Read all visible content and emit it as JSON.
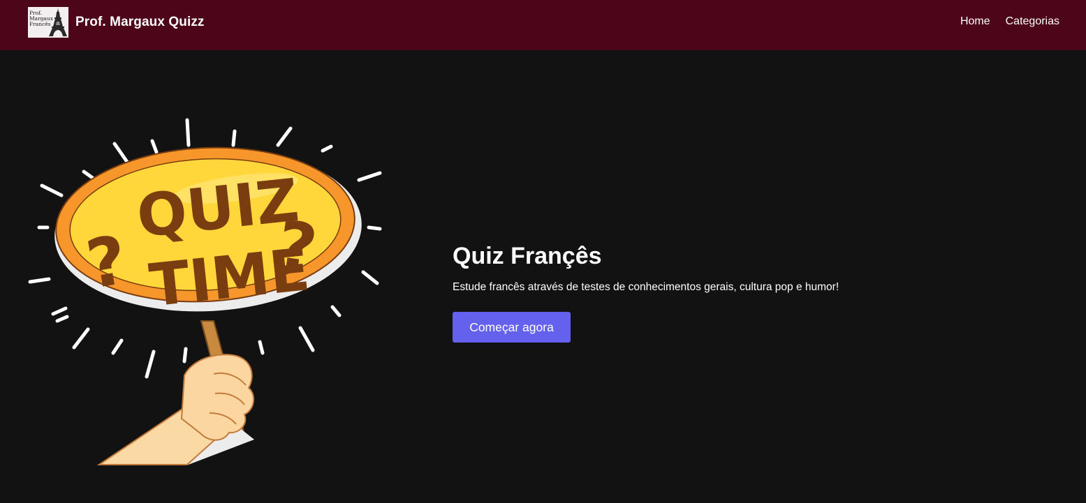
{
  "navbar": {
    "logo_text": [
      "Prof.",
      "Margaux",
      "Francês"
    ],
    "brand_title": "Prof. Margaux Quizz",
    "links": [
      "Home",
      "Categorias"
    ],
    "background_color": "#4d0519"
  },
  "hero": {
    "illustration": {
      "icon": "quiz-time-sign-illustration",
      "sign_text_line1": "QUIZ",
      "sign_text_line2": "TIME",
      "marks": "?"
    },
    "title": "Quiz Françês",
    "subtitle": "Estude francês através de testes de conhecimentos gerais, cultura pop e humor!",
    "cta_label": "Começar agora",
    "cta_color": "#6461ee"
  },
  "page_background": "#121212"
}
